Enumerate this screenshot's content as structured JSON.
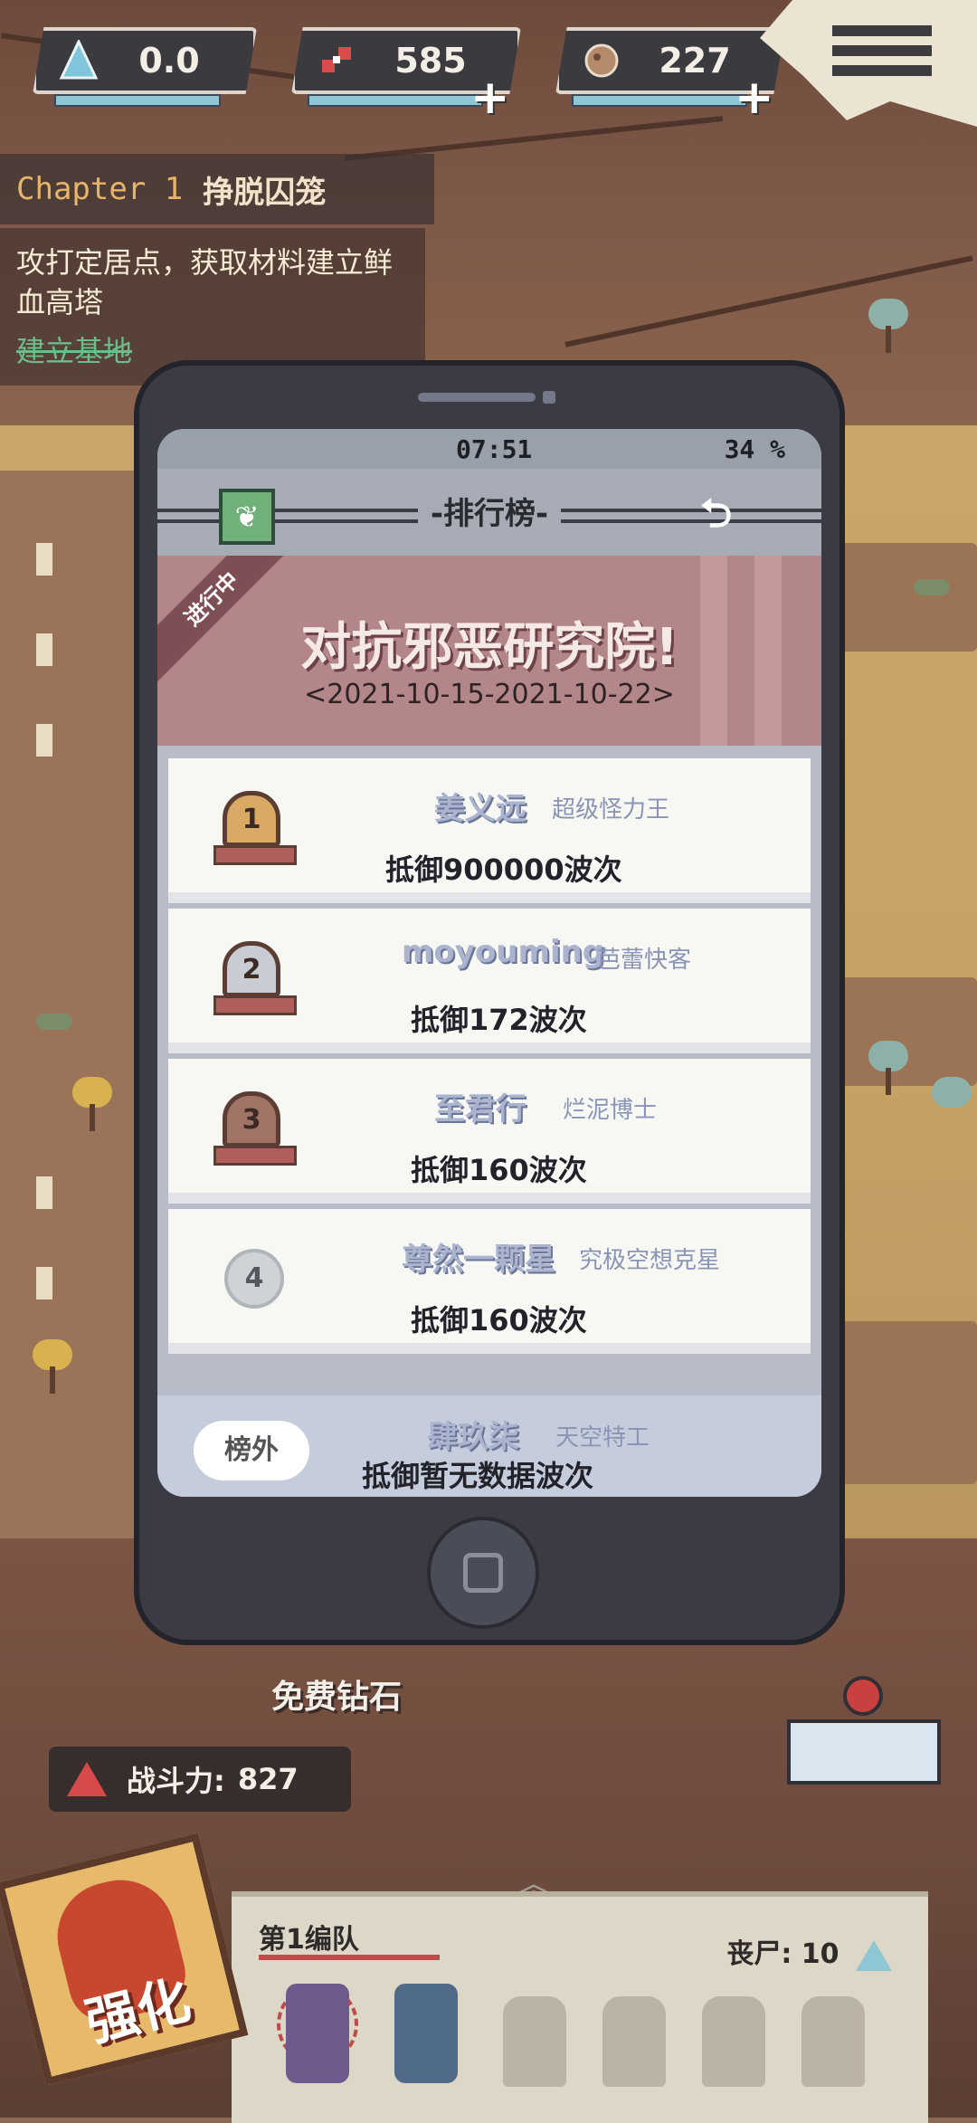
{
  "hud": {
    "resource1": "0.0",
    "resource2": "585",
    "resource3": "227",
    "resource1_icon": "crystal-icon",
    "resource2_icon": "gene-icon",
    "resource3_icon": "ore-icon",
    "plus": "+"
  },
  "chapter": {
    "label": "Chapter 1",
    "name": "挣脱囚笼",
    "quest": "攻打定居点，获取材料建立鲜血高塔",
    "task_link": "建立基地"
  },
  "phone": {
    "time": "07:51",
    "battery": "34 %",
    "title": "-排行榜-",
    "event_status": "进行中",
    "event_title": "对抗邪恶研究院!",
    "event_dates": "<2021-10-15-2021-10-22>",
    "rankings": [
      {
        "rank": "1",
        "name": "姜义远",
        "title": "超级怪力王",
        "score": "抵御900000波次"
      },
      {
        "rank": "2",
        "name": "moyouming",
        "title": "芭蕾快客",
        "score": "抵御172波次"
      },
      {
        "rank": "3",
        "name": "至君行",
        "title": "烂泥博士",
        "score": "抵御160波次"
      },
      {
        "rank": "4",
        "name": "尊然一颗星",
        "title": "究极空想克星",
        "score": "抵御160波次"
      }
    ],
    "self": {
      "badge": "榜外",
      "name": "肆玖柒",
      "title": "天空特工",
      "score": "抵御暂无数据波次"
    }
  },
  "bottom": {
    "free_diamond": "免费钻石",
    "power_label": "战斗力:",
    "power_value": "827",
    "enhance": "强化",
    "squad_name": "第1编队",
    "zombie_label": "丧尸:",
    "zombie_count": "10",
    "chevron": "︽"
  },
  "colors": {
    "accent_red": "#c24a4a",
    "banner": "#b3868a",
    "phone_body": "#3a3b44",
    "name_text": "#aab4cf"
  }
}
